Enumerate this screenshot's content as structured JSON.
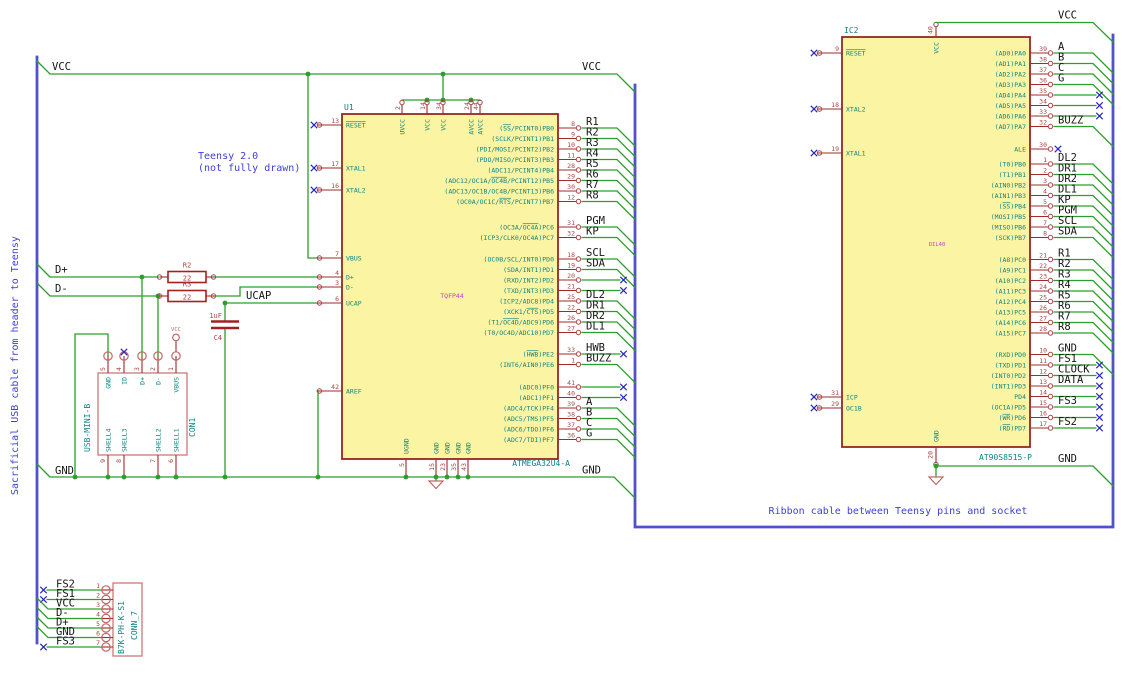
{
  "notes": {
    "teensy_line1": "Teensy 2.0",
    "teensy_line2": "(not fully drawn)",
    "left_bus_note": "Sacrificial USB cable from header to Teensy",
    "ribbon_note": "Ribbon cable between Teensy pins and socket"
  },
  "net_labels": {
    "vcc_top_left": "VCC",
    "vcc_top_right_u1": "VCC",
    "vcc_top_ic2": "VCC",
    "d_plus": "D+",
    "d_minus": "D-",
    "ucap": "UCAP",
    "gnd_left": "GND",
    "gnd_right_u1": "GND",
    "gnd_ic2": "GND"
  },
  "components": {
    "U1": {
      "ref": "U1",
      "value": "ATMEGA32U4-A",
      "footprint": "TQFP44",
      "left_pins": [
        {
          "num": "13",
          "name": "~RESET~",
          "nc": true
        },
        {
          "num": "17",
          "name": "XTAL1",
          "nc": true
        },
        {
          "num": "16",
          "name": "XTAL2",
          "nc": true
        },
        {
          "num": "7",
          "name": "VBUS"
        },
        {
          "num": "4",
          "name": "D+"
        },
        {
          "num": "3",
          "name": "D-"
        },
        {
          "num": "6",
          "name": "UCAP"
        },
        {
          "num": "42",
          "name": "AREF"
        }
      ],
      "top_pins": [
        {
          "num": "2",
          "name": "UVCC"
        },
        {
          "num": "14",
          "name": "VCC"
        },
        {
          "num": "34",
          "name": "VCC"
        },
        {
          "num": "24",
          "name": "AVCC"
        },
        {
          "num": "44",
          "name": "AVCC"
        }
      ],
      "bottom_pins": [
        {
          "num": "5",
          "name": "UGND"
        },
        {
          "num": "15",
          "name": "GND"
        },
        {
          "num": "23",
          "name": "GND"
        },
        {
          "num": "35",
          "name": "GND"
        },
        {
          "num": "43",
          "name": "GND"
        }
      ],
      "right_pins": [
        {
          "num": "8",
          "name": "(~SS~/PCINT0)PB0",
          "net": "R1"
        },
        {
          "num": "9",
          "name": "(SCLK/PCINT1)PB1",
          "net": "R2"
        },
        {
          "num": "10",
          "name": "(PDI/MOSI/PCINT2)PB2",
          "net": "R3"
        },
        {
          "num": "11",
          "name": "(PDO/MISO/PCINT3)PB3",
          "net": "R4"
        },
        {
          "num": "28",
          "name": "(ADC11/PCINT4)PB4",
          "net": "R5"
        },
        {
          "num": "29",
          "name": "(ADC12/OC1A/~OC4B~/PCINT12)PB5",
          "net": "R6"
        },
        {
          "num": "30",
          "name": "(ADC13/OC1B/OC4B/PCINT13)PB6",
          "net": "R7"
        },
        {
          "num": "12",
          "name": "(OC0A/OC1C/~RTS~/PCINT7)PB7",
          "net": "R8"
        },
        {
          "num": "31",
          "name": "(OC3A/~OC4A~)PC6",
          "net": "PGM"
        },
        {
          "num": "32",
          "name": "(ICP3/CLK0/OC4A)PC7",
          "net": "KP"
        },
        {
          "num": "18",
          "name": "(OC0B/SCL/INT0)PD0",
          "net": "SCL"
        },
        {
          "num": "19",
          "name": "(SDA/INT1)PD1",
          "net": "SDA"
        },
        {
          "num": "20",
          "name": "(RXD/INT2)PD2",
          "nc": true
        },
        {
          "num": "21",
          "name": "(TXD/INT3)PD3",
          "nc": true
        },
        {
          "num": "25",
          "name": "(ICP2/ADC8)PD4",
          "net": "DL2"
        },
        {
          "num": "22",
          "name": "(XCK1/~CTS~)PD5",
          "net": "DR1"
        },
        {
          "num": "26",
          "name": "(T1/~OC4D~/ADC9)PD6",
          "net": "DR2"
        },
        {
          "num": "27",
          "name": "(T0/OC4D/ADC10)PD7",
          "net": "DL1"
        },
        {
          "num": "33",
          "name": "(~HWB~)PE2",
          "net": "HWB",
          "nc": true
        },
        {
          "num": "1",
          "name": "(INT6/AIN0)PE6",
          "net": "BUZZ"
        },
        {
          "num": "41",
          "name": "(ADC0)PF0",
          "nc": true
        },
        {
          "num": "40",
          "name": "(ADC1)PF1",
          "nc": true
        },
        {
          "num": "39",
          "name": "(ADC4/TCK)PF4",
          "net": "A"
        },
        {
          "num": "38",
          "name": "(ADC5/TMS)PF5",
          "net": "B"
        },
        {
          "num": "37",
          "name": "(ADC6/TDO)PF6",
          "net": "C"
        },
        {
          "num": "36",
          "name": "(ADC7/TDI)PF7",
          "net": "G"
        }
      ]
    },
    "IC2": {
      "ref": "IC2",
      "value": "AT90S8515-P",
      "footprint": "DIL40",
      "left_pins": [
        {
          "num": "9",
          "name": "~RESET~",
          "nc": true
        },
        {
          "num": "18",
          "name": "XTAL2",
          "nc": true
        },
        {
          "num": "19",
          "name": "XTAL1",
          "nc": true
        },
        {
          "num": "31",
          "name": "ICP",
          "nc": true
        },
        {
          "num": "29",
          "name": "OC1B",
          "nc": true
        }
      ],
      "top_pins": [
        {
          "num": "40",
          "name": "VCC"
        }
      ],
      "bottom_pins": [
        {
          "num": "20",
          "name": "GND"
        }
      ],
      "right_pins": [
        {
          "num": "39",
          "name": "(AD0)PA0",
          "net": "A"
        },
        {
          "num": "38",
          "name": "(AD1)PA1",
          "net": "B"
        },
        {
          "num": "37",
          "name": "(AD2)PA2",
          "net": "C"
        },
        {
          "num": "36",
          "name": "(AD3)PA3",
          "net": "G"
        },
        {
          "num": "35",
          "name": "(AD4)PA4",
          "nc": true
        },
        {
          "num": "34",
          "name": "(AD5)PA5",
          "nc": true
        },
        {
          "num": "33",
          "name": "(AD6)PA6",
          "nc": true
        },
        {
          "num": "32",
          "name": "(AD7)PA7",
          "net": "BUZZ"
        },
        {
          "num": "30",
          "name": "ALE",
          "nc": true,
          "ncAtPin": true
        },
        {
          "num": "1",
          "name": "(T0)PB0",
          "net": "DL2"
        },
        {
          "num": "2",
          "name": "(T1)PB1",
          "net": "DR1"
        },
        {
          "num": "3",
          "name": "(AIN0)PB2",
          "net": "DR2"
        },
        {
          "num": "4",
          "name": "(AIN1)PB3",
          "net": "DL1"
        },
        {
          "num": "5",
          "name": "(~SS~)PB4",
          "net": "KP"
        },
        {
          "num": "6",
          "name": "(MOSI)PB5",
          "net": "PGM"
        },
        {
          "num": "7",
          "name": "(MISO)PB6",
          "net": "SCL"
        },
        {
          "num": "8",
          "name": "(SCK)PB7",
          "net": "SDA"
        },
        {
          "num": "21",
          "name": "(A8)PC0",
          "net": "R1"
        },
        {
          "num": "22",
          "name": "(A9)PC1",
          "net": "R2"
        },
        {
          "num": "23",
          "name": "(A10)PC2",
          "net": "R3"
        },
        {
          "num": "24",
          "name": "(A11)PC3",
          "net": "R4"
        },
        {
          "num": "25",
          "name": "(A12)PC4",
          "net": "R5"
        },
        {
          "num": "26",
          "name": "(A13)PC5",
          "net": "R6"
        },
        {
          "num": "27",
          "name": "(A14)PC6",
          "net": "R7"
        },
        {
          "num": "28",
          "name": "(A15)PC7",
          "net": "R8"
        },
        {
          "num": "10",
          "name": "(RXD)PD0",
          "net": "GND"
        },
        {
          "num": "11",
          "name": "(TXD)PD1",
          "net": "FS1",
          "nc": true
        },
        {
          "num": "12",
          "name": "(INT0)PD2",
          "net": "CLOCK",
          "nc": true
        },
        {
          "num": "13",
          "name": "(INT1)PD3",
          "net": "DATA",
          "nc": true
        },
        {
          "num": "14",
          "name": "PD4",
          "nc": true
        },
        {
          "num": "15",
          "name": "(OC1A)PD5",
          "net": "FS3",
          "nc": true
        },
        {
          "num": "16",
          "name": "(~WR~)PD6",
          "nc": true
        },
        {
          "num": "17",
          "name": "(~RD~)PD7",
          "net": "FS2",
          "nc": true
        }
      ]
    },
    "CON1": {
      "ref": "CON1",
      "value": "USB-MINI-B",
      "top_pins": [
        {
          "num": "5",
          "name": "GND"
        },
        {
          "num": "4",
          "name": "ID",
          "nc": true
        },
        {
          "num": "3",
          "name": "D+"
        },
        {
          "num": "2",
          "name": "D-"
        },
        {
          "num": "1",
          "name": "VBUS",
          "power": "VCC"
        }
      ],
      "bottom_pins": [
        {
          "num": "9",
          "name": "SHELL4"
        },
        {
          "num": "8",
          "name": "SHELL3"
        },
        {
          "num": "7",
          "name": "SHELL2"
        },
        {
          "num": "6",
          "name": "SHELL1"
        }
      ]
    },
    "CONN7": {
      "ref": "CONN_7",
      "value": "B7K-PH-K-S1",
      "pins": [
        {
          "num": "1",
          "net": "FS2",
          "nc": true
        },
        {
          "num": "2",
          "net": "FS1",
          "nc": true
        },
        {
          "num": "3",
          "net": "VCC"
        },
        {
          "num": "4",
          "net": "D-"
        },
        {
          "num": "5",
          "net": "D+"
        },
        {
          "num": "6",
          "net": "GND"
        },
        {
          "num": "7",
          "net": "FS3",
          "nc": true
        }
      ]
    },
    "R2": {
      "ref": "R2",
      "value": "22"
    },
    "R3": {
      "ref": "R3",
      "value": "22"
    },
    "C4": {
      "ref": "C4",
      "value": "1uF"
    }
  },
  "colors": {
    "wire_green": "#2B9F2B",
    "bus_blue": "#5151CB",
    "note_blue": "#4040DC",
    "body_fill": "#FBF5A3",
    "body_outline": "#8F1A1A",
    "pin_name_teal": "#0E8383",
    "pin_num_red": "#A64545",
    "footprint_magenta": "#C33FC3",
    "nc_blue": "#2525BE",
    "label_black": "#151515"
  }
}
